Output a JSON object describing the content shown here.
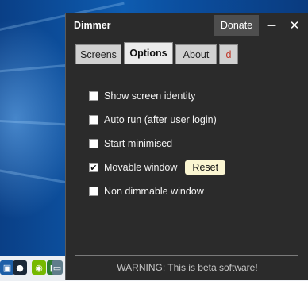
{
  "window": {
    "title": "Dimmer",
    "donate_label": "Donate",
    "minimize_glyph": "—",
    "close_glyph": "✕"
  },
  "tabs": [
    {
      "label": "Screens",
      "active": false
    },
    {
      "label": "Options",
      "active": true
    },
    {
      "label": "About",
      "active": false
    },
    {
      "label": "d",
      "active": false
    }
  ],
  "options": [
    {
      "label": "Show screen identity",
      "checked": false
    },
    {
      "label": "Auto run (after user login)",
      "checked": false
    },
    {
      "label": "Start minimised",
      "checked": false
    },
    {
      "label": "Movable window",
      "checked": true
    },
    {
      "label": "Non dimmable window",
      "checked": false
    }
  ],
  "reset_label": "Reset",
  "warning": "WARNING: This is beta software!",
  "taskbar_icons": [
    "store-icon",
    "steam-icon",
    "nvidia-icon",
    "app-icon",
    "display-icon"
  ]
}
